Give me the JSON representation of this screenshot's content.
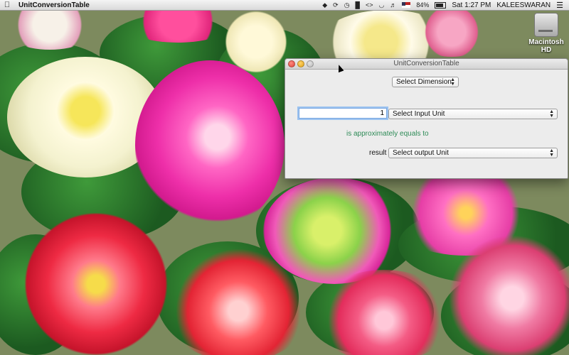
{
  "menubar": {
    "app_name": "UnitConversionTable",
    "battery": "84%",
    "clock": "Sat 1:27 PM",
    "user": "KALEESWARAN",
    "icons": [
      "apple-icon",
      "dropbox-icon",
      "sync-icon",
      "time-machine-icon",
      "bluetooth-icon",
      "code-icon",
      "wifi-icon",
      "volume-icon",
      "flag-icon",
      "battery-icon",
      "list-icon"
    ]
  },
  "desktop": {
    "hd_label": "Macintosh HD"
  },
  "window": {
    "title": "UnitConversionTable",
    "dimension_popup": "Select Dimension",
    "input_value": "1",
    "input_unit_popup": "Select Input Unit",
    "approx_text": "is approximately equals to",
    "result_label": "result",
    "output_unit_popup": "Select output Unit"
  },
  "colors": {
    "approx_text": "#2e8b57",
    "focus_ring": "#9cc3f0"
  }
}
